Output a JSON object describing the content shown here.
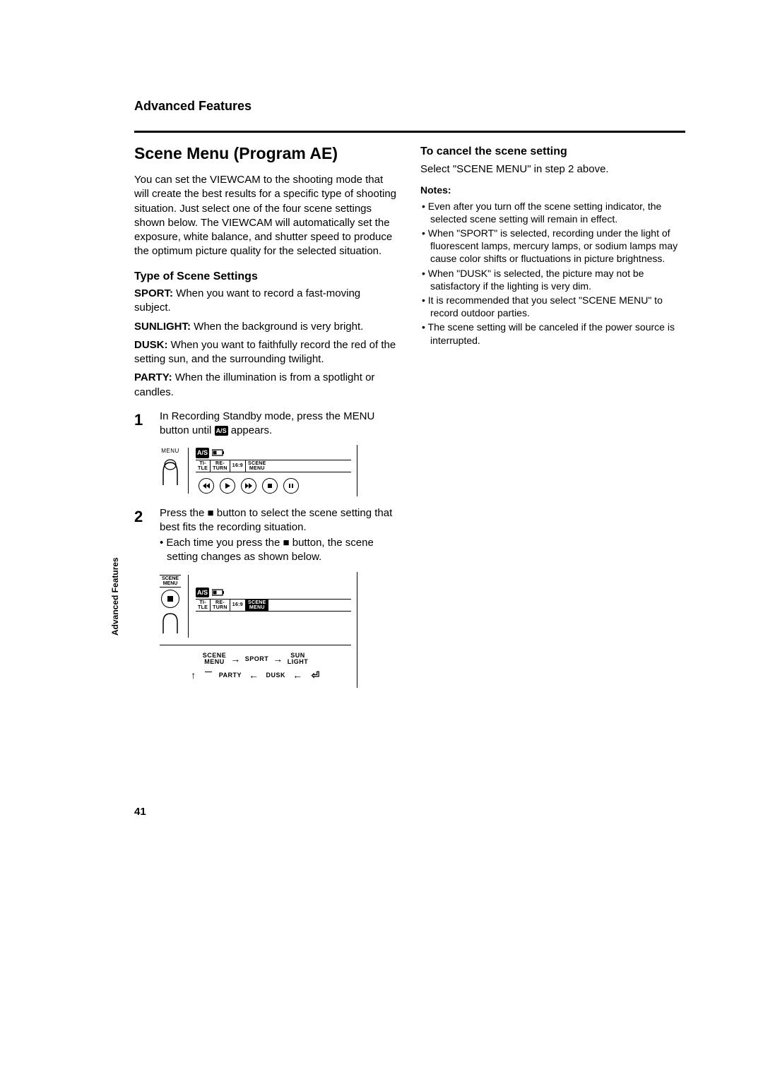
{
  "header": {
    "section": "Advanced Features"
  },
  "title": "Scene Menu (Program AE)",
  "intro": "You can set the VIEWCAM to the shooting mode that will create the best results for a specific type of shooting situation. Just select one of the four scene settings shown below. The VIEWCAM will automatically set the exposure, white balance, and shutter speed to produce the optimum picture quality for the selected situation.",
  "types_heading": "Type of Scene Settings",
  "scenes": {
    "sport": {
      "name": "SPORT:",
      "desc": " When you want to record a fast-moving subject."
    },
    "sunlight": {
      "name": "SUNLIGHT:",
      "desc": " When the background is very bright."
    },
    "dusk": {
      "name": "DUSK:",
      "desc": " When you want to faithfully record the red of the setting sun, and the surrounding twilight."
    },
    "party": {
      "name": "PARTY:",
      "desc": " When the illumination is from a spotlight or candles."
    }
  },
  "steps": {
    "s1": {
      "num": "1",
      "text_a": "In Recording Standby mode, press the MENU button until ",
      "text_b": " appears."
    },
    "s2": {
      "num": "2",
      "text": "Press the ■ button to select the scene setting that best fits the recording situation.",
      "sub": "• Each time you press the ■ button, the scene setting changes as shown below."
    }
  },
  "fig1": {
    "menu_label": "MENU",
    "as_badge": "A/S",
    "strip": {
      "title": "TI-\nTLE",
      "return": "RE-\nTURN",
      "ratio": "16:9",
      "scene": "SCENE\nMENU"
    }
  },
  "fig2": {
    "btn_label": "SCENE\nMENU",
    "as_badge": "A/S",
    "strip": {
      "title": "TI-\nTLE",
      "return": "RE-\nTURN",
      "ratio": "16:9",
      "scene": "SCENE\nMENU"
    },
    "cycle": {
      "scene": "SCENE\nMENU",
      "sport": "SPORT",
      "sun": "SUN\nLIGHT",
      "party": "PARTY",
      "dusk": "DUSK"
    }
  },
  "right": {
    "cancel_h": "To cancel the scene setting",
    "cancel_t": "Select \"SCENE MENU\" in step 2 above.",
    "notes_h": "Notes:",
    "notes": [
      "Even after you turn off the scene setting indicator, the selected scene setting will remain in effect.",
      "When \"SPORT\" is selected, recording under the light of fluorescent lamps, mercury lamps, or sodium lamps may cause color shifts or fluctuations in picture brightness.",
      "When \"DUSK\" is selected, the picture may not be satisfactory if the lighting is very dim.",
      "It is recommended that you select \"SCENE MENU\" to record outdoor parties.",
      "The scene setting will be canceled if the power source is interrupted."
    ]
  },
  "side_tab": "Advanced Features",
  "page": "41"
}
